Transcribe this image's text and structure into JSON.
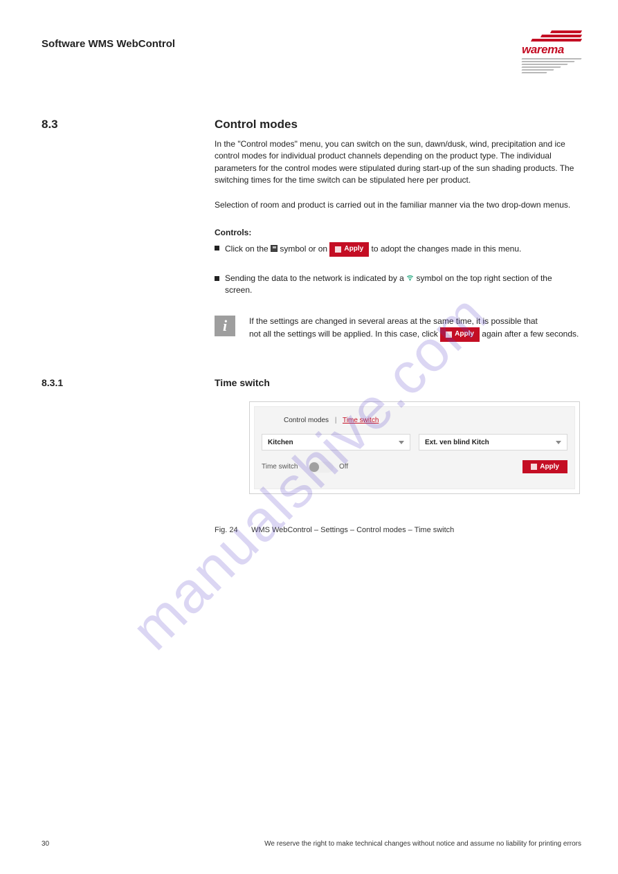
{
  "header": {
    "title": "Software WMS WebControl"
  },
  "logo": {
    "brand": "warema"
  },
  "section": {
    "number": "8.3",
    "title": "Control modes"
  },
  "intro1": "In the \"Control modes\" menu, you can switch on the sun, dawn/dusk, wind, precipitation and ice control modes for individual product channels depending on the product type. The individual parameters for the control modes were stipulated during start-up of the sun shading products. The switching times for the time switch can be stipulated here per product.",
  "intro2": "Selection of room and product is carried out in the familiar manner via the two drop-down menus.",
  "controlsHeading": "Controls:",
  "bullets": {
    "b1_a": "Click on the ",
    "b1_b": " symbol or on ",
    "b1_c": " to adopt the changes made in this menu.",
    "b2_a": "Sending the data to the network is indicated by a ",
    "b2_b": " symbol on the top right section of the screen."
  },
  "info": {
    "line1": "If the settings are changed in several areas at the same time, it is possible that",
    "line2_a": "not all the settings will be applied. In this case, click ",
    "line2_b": " again after a few seconds."
  },
  "subsection": {
    "number": "8.3.1",
    "title": "Time switch"
  },
  "shot": {
    "breadcrumb": {
      "parent": "Control modes",
      "current": "Time switch"
    },
    "select1": "Kitchen",
    "select2": "Ext. ven blind Kitch",
    "toggleLabel": "Time switch",
    "toggleState": "Off",
    "applyLabel": "Apply"
  },
  "applyLabel": "Apply",
  "figure": {
    "num": "Fig. 24",
    "caption": "WMS WebControl – Settings – Control modes – Time switch"
  },
  "footer": {
    "page": "30",
    "right": "We reserve the right to make technical changes without notice and assume no liability for printing errors"
  },
  "watermark": "manualshive.com"
}
